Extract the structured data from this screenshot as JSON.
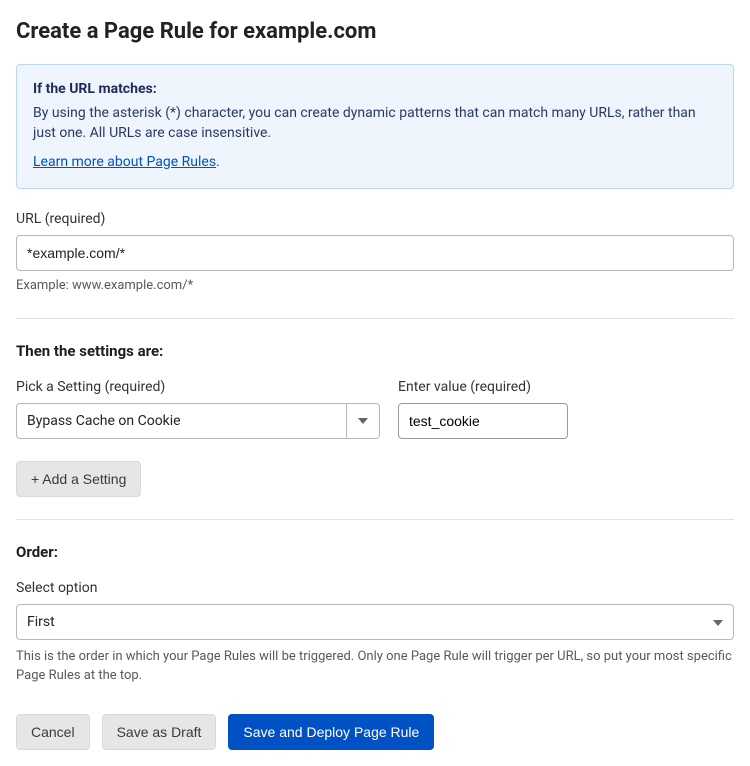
{
  "title": "Create a Page Rule for example.com",
  "infoBox": {
    "heading": "If the URL matches:",
    "body": "By using the asterisk (*) character, you can create dynamic patterns that can match many URLs, rather than just one. All URLs are case insensitive.",
    "linkText": "Learn more about Page Rules"
  },
  "urlField": {
    "label": "URL (required)",
    "value": "*example.com/*",
    "hint": "Example: www.example.com/*"
  },
  "settingsHeading": "Then the settings are:",
  "settingPicker": {
    "label": "Pick a Setting (required)",
    "selected": "Bypass Cache on Cookie"
  },
  "valueField": {
    "label": "Enter value (required)",
    "value": "test_cookie"
  },
  "addSettingLabel": "+ Add a Setting",
  "orderHeading": "Order:",
  "orderField": {
    "label": "Select option",
    "selected": "First",
    "hint": "This is the order in which your Page Rules will be triggered. Only one Page Rule will trigger per URL, so put your most specific Page Rules at the top."
  },
  "footer": {
    "cancel": "Cancel",
    "draft": "Save as Draft",
    "deploy": "Save and Deploy Page Rule"
  }
}
